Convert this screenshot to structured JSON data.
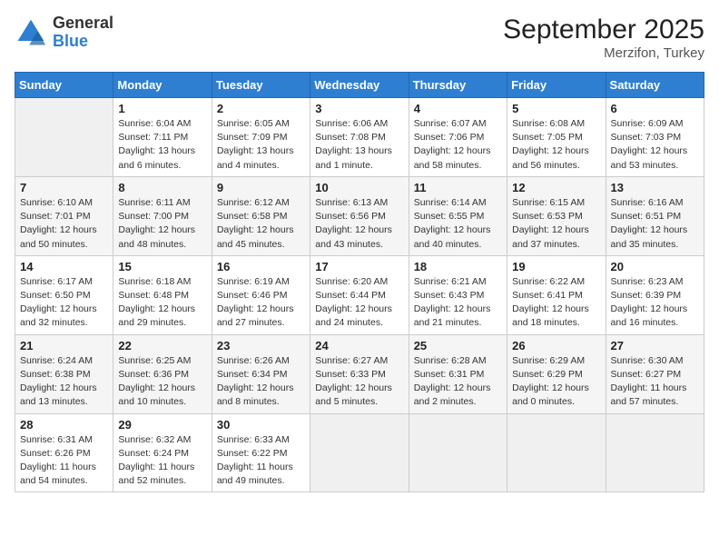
{
  "header": {
    "logo": {
      "line1": "General",
      "line2": "Blue"
    },
    "title": "September 2025",
    "subtitle": "Merzifon, Turkey"
  },
  "weekdays": [
    "Sunday",
    "Monday",
    "Tuesday",
    "Wednesday",
    "Thursday",
    "Friday",
    "Saturday"
  ],
  "weeks": [
    [
      {
        "day": "",
        "sunrise": "",
        "sunset": "",
        "daylight": ""
      },
      {
        "day": "1",
        "sunrise": "Sunrise: 6:04 AM",
        "sunset": "Sunset: 7:11 PM",
        "daylight": "Daylight: 13 hours and 6 minutes."
      },
      {
        "day": "2",
        "sunrise": "Sunrise: 6:05 AM",
        "sunset": "Sunset: 7:09 PM",
        "daylight": "Daylight: 13 hours and 4 minutes."
      },
      {
        "day": "3",
        "sunrise": "Sunrise: 6:06 AM",
        "sunset": "Sunset: 7:08 PM",
        "daylight": "Daylight: 13 hours and 1 minute."
      },
      {
        "day": "4",
        "sunrise": "Sunrise: 6:07 AM",
        "sunset": "Sunset: 7:06 PM",
        "daylight": "Daylight: 12 hours and 58 minutes."
      },
      {
        "day": "5",
        "sunrise": "Sunrise: 6:08 AM",
        "sunset": "Sunset: 7:05 PM",
        "daylight": "Daylight: 12 hours and 56 minutes."
      },
      {
        "day": "6",
        "sunrise": "Sunrise: 6:09 AM",
        "sunset": "Sunset: 7:03 PM",
        "daylight": "Daylight: 12 hours and 53 minutes."
      }
    ],
    [
      {
        "day": "7",
        "sunrise": "Sunrise: 6:10 AM",
        "sunset": "Sunset: 7:01 PM",
        "daylight": "Daylight: 12 hours and 50 minutes."
      },
      {
        "day": "8",
        "sunrise": "Sunrise: 6:11 AM",
        "sunset": "Sunset: 7:00 PM",
        "daylight": "Daylight: 12 hours and 48 minutes."
      },
      {
        "day": "9",
        "sunrise": "Sunrise: 6:12 AM",
        "sunset": "Sunset: 6:58 PM",
        "daylight": "Daylight: 12 hours and 45 minutes."
      },
      {
        "day": "10",
        "sunrise": "Sunrise: 6:13 AM",
        "sunset": "Sunset: 6:56 PM",
        "daylight": "Daylight: 12 hours and 43 minutes."
      },
      {
        "day": "11",
        "sunrise": "Sunrise: 6:14 AM",
        "sunset": "Sunset: 6:55 PM",
        "daylight": "Daylight: 12 hours and 40 minutes."
      },
      {
        "day": "12",
        "sunrise": "Sunrise: 6:15 AM",
        "sunset": "Sunset: 6:53 PM",
        "daylight": "Daylight: 12 hours and 37 minutes."
      },
      {
        "day": "13",
        "sunrise": "Sunrise: 6:16 AM",
        "sunset": "Sunset: 6:51 PM",
        "daylight": "Daylight: 12 hours and 35 minutes."
      }
    ],
    [
      {
        "day": "14",
        "sunrise": "Sunrise: 6:17 AM",
        "sunset": "Sunset: 6:50 PM",
        "daylight": "Daylight: 12 hours and 32 minutes."
      },
      {
        "day": "15",
        "sunrise": "Sunrise: 6:18 AM",
        "sunset": "Sunset: 6:48 PM",
        "daylight": "Daylight: 12 hours and 29 minutes."
      },
      {
        "day": "16",
        "sunrise": "Sunrise: 6:19 AM",
        "sunset": "Sunset: 6:46 PM",
        "daylight": "Daylight: 12 hours and 27 minutes."
      },
      {
        "day": "17",
        "sunrise": "Sunrise: 6:20 AM",
        "sunset": "Sunset: 6:44 PM",
        "daylight": "Daylight: 12 hours and 24 minutes."
      },
      {
        "day": "18",
        "sunrise": "Sunrise: 6:21 AM",
        "sunset": "Sunset: 6:43 PM",
        "daylight": "Daylight: 12 hours and 21 minutes."
      },
      {
        "day": "19",
        "sunrise": "Sunrise: 6:22 AM",
        "sunset": "Sunset: 6:41 PM",
        "daylight": "Daylight: 12 hours and 18 minutes."
      },
      {
        "day": "20",
        "sunrise": "Sunrise: 6:23 AM",
        "sunset": "Sunset: 6:39 PM",
        "daylight": "Daylight: 12 hours and 16 minutes."
      }
    ],
    [
      {
        "day": "21",
        "sunrise": "Sunrise: 6:24 AM",
        "sunset": "Sunset: 6:38 PM",
        "daylight": "Daylight: 12 hours and 13 minutes."
      },
      {
        "day": "22",
        "sunrise": "Sunrise: 6:25 AM",
        "sunset": "Sunset: 6:36 PM",
        "daylight": "Daylight: 12 hours and 10 minutes."
      },
      {
        "day": "23",
        "sunrise": "Sunrise: 6:26 AM",
        "sunset": "Sunset: 6:34 PM",
        "daylight": "Daylight: 12 hours and 8 minutes."
      },
      {
        "day": "24",
        "sunrise": "Sunrise: 6:27 AM",
        "sunset": "Sunset: 6:33 PM",
        "daylight": "Daylight: 12 hours and 5 minutes."
      },
      {
        "day": "25",
        "sunrise": "Sunrise: 6:28 AM",
        "sunset": "Sunset: 6:31 PM",
        "daylight": "Daylight: 12 hours and 2 minutes."
      },
      {
        "day": "26",
        "sunrise": "Sunrise: 6:29 AM",
        "sunset": "Sunset: 6:29 PM",
        "daylight": "Daylight: 12 hours and 0 minutes."
      },
      {
        "day": "27",
        "sunrise": "Sunrise: 6:30 AM",
        "sunset": "Sunset: 6:27 PM",
        "daylight": "Daylight: 11 hours and 57 minutes."
      }
    ],
    [
      {
        "day": "28",
        "sunrise": "Sunrise: 6:31 AM",
        "sunset": "Sunset: 6:26 PM",
        "daylight": "Daylight: 11 hours and 54 minutes."
      },
      {
        "day": "29",
        "sunrise": "Sunrise: 6:32 AM",
        "sunset": "Sunset: 6:24 PM",
        "daylight": "Daylight: 11 hours and 52 minutes."
      },
      {
        "day": "30",
        "sunrise": "Sunrise: 6:33 AM",
        "sunset": "Sunset: 6:22 PM",
        "daylight": "Daylight: 11 hours and 49 minutes."
      },
      {
        "day": "",
        "sunrise": "",
        "sunset": "",
        "daylight": ""
      },
      {
        "day": "",
        "sunrise": "",
        "sunset": "",
        "daylight": ""
      },
      {
        "day": "",
        "sunrise": "",
        "sunset": "",
        "daylight": ""
      },
      {
        "day": "",
        "sunrise": "",
        "sunset": "",
        "daylight": ""
      }
    ]
  ]
}
